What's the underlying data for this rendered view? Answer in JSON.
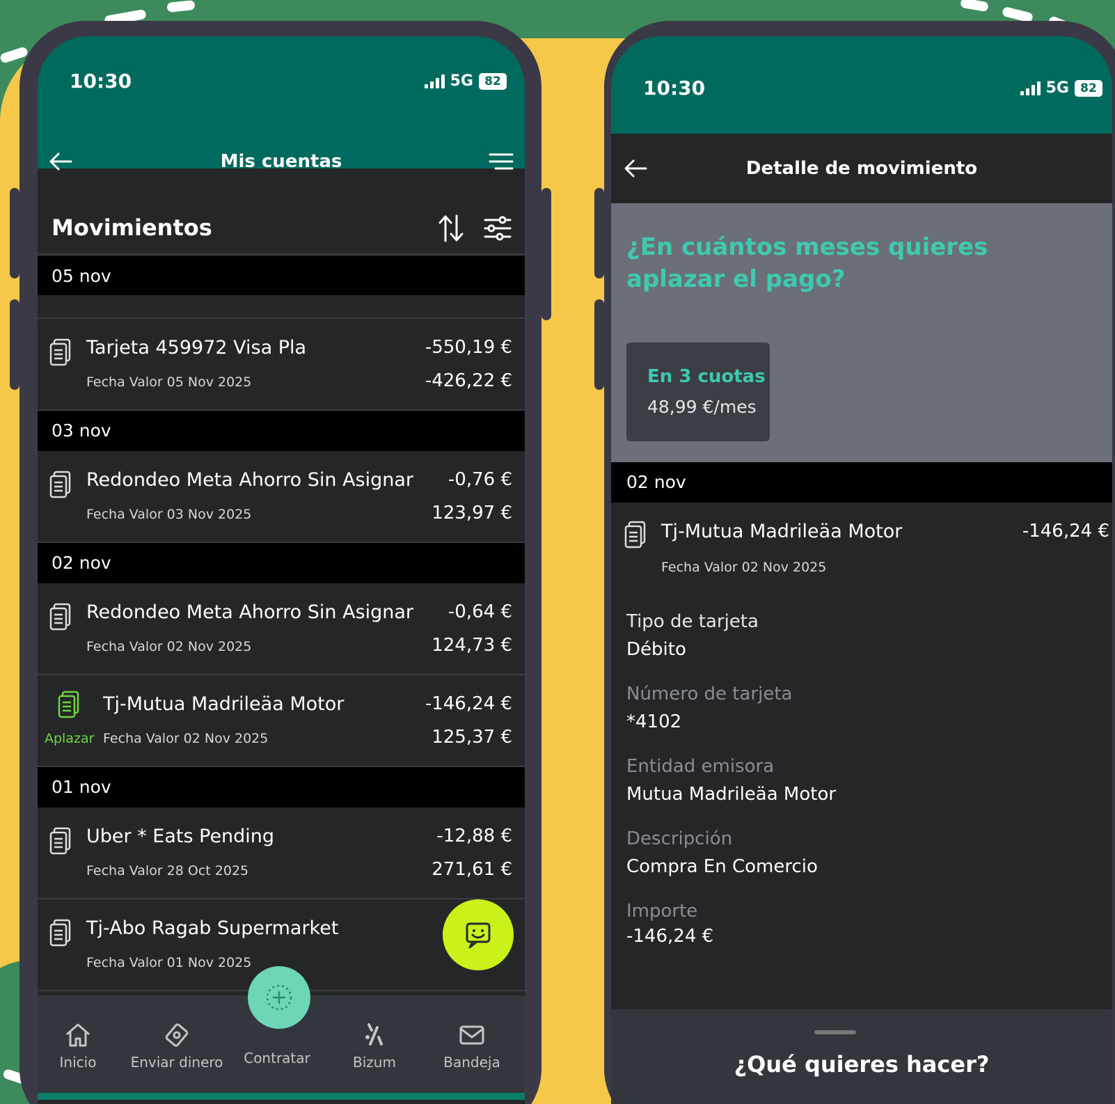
{
  "left_phone": {
    "status": {
      "time": "10:30",
      "network": "5G",
      "battery": "82"
    },
    "header": {
      "title": "Mis cuentas"
    },
    "section_title": "Movimientos",
    "groups": [
      {
        "date": "05 nov"
      },
      {
        "date": "03 nov"
      },
      {
        "date": "02 nov"
      },
      {
        "date": "01 nov"
      }
    ],
    "transactions": [
      {
        "name": "Tarjeta 459972 Visa Pla",
        "date": "Fecha Valor 05 Nov 2025",
        "amount": "-550,19 €",
        "balance": "-426,22 €"
      },
      {
        "name": "Redondeo Meta Ahorro Sin Asignar",
        "date": "Fecha Valor 03 Nov 2025",
        "amount": "-0,76 €",
        "balance": "123,97 €"
      },
      {
        "name": "Redondeo Meta Ahorro Sin Asignar",
        "date": "Fecha Valor 02 Nov 2025",
        "amount": "-0,64 €",
        "balance": "124,73 €"
      },
      {
        "name": "Tj-Mutua Madrileäa Motor",
        "date": "Fecha Valor 02 Nov 2025",
        "amount": "-146,24 €",
        "balance": "125,37 €",
        "tag": "Aplazar"
      },
      {
        "name": "Uber * Eats Pending",
        "date": "Fecha Valor 28 Oct 2025",
        "amount": "-12,88 €",
        "balance": "271,61 €"
      },
      {
        "name": "Tj-Abo Ragab Supermarket",
        "date": "Fecha Valor 01 Nov 2025"
      }
    ],
    "nav": [
      {
        "label": "Inicio"
      },
      {
        "label": "Enviar dinero"
      },
      {
        "label": "Contratar"
      },
      {
        "label": "Bizum"
      },
      {
        "label": "Bandeja"
      }
    ],
    "colors": {
      "header": "#006a5e",
      "aplazar": "#6fd63d",
      "chat_fab": "#c8f21a",
      "center_fab": "#6dd6b6"
    }
  },
  "right_phone": {
    "status": {
      "time": "10:30",
      "network": "5G",
      "battery": "82"
    },
    "header": {
      "title": "Detalle de movimiento"
    },
    "defer": {
      "question": "¿En cuántos meses quieres aplazar el pago?",
      "option_title": "En 3 cuotas",
      "option_amount": "48,99 €/mes"
    },
    "group_date": "02 nov",
    "transaction": {
      "name": "Tj-Mutua Madrileäa Motor",
      "date": "Fecha Valor 02 Nov 2025",
      "amount": "-146,24 €"
    },
    "details": [
      {
        "label": "Tipo de tarjeta",
        "value": "Débito"
      },
      {
        "label": "Número de tarjeta",
        "value": "*4102"
      },
      {
        "label": "Entidad emisora",
        "value": "Mutua Madrileäa Motor"
      },
      {
        "label": "Descripción",
        "value": "Compra En Comercio"
      },
      {
        "label": "Importe",
        "value": "-146,24 €"
      }
    ],
    "action_panel_title": "¿Qué quieres hacer?",
    "colors": {
      "accent_teal": "#3fc9b0",
      "defer_panel": "#6a6f78"
    }
  }
}
